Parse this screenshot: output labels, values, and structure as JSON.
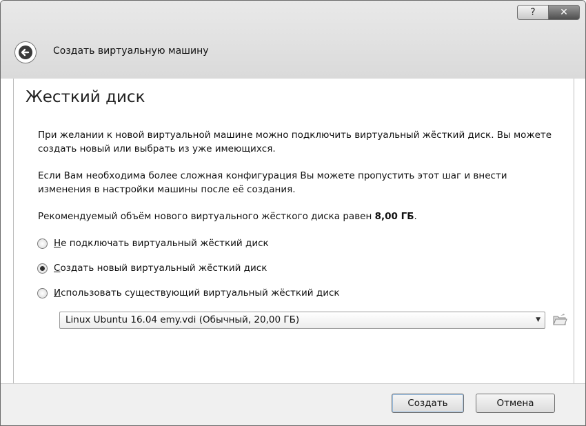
{
  "window": {
    "title": "Создать виртуальную машину",
    "help_glyph": "?",
    "close_glyph": "✕"
  },
  "page": {
    "heading": "Жесткий диск",
    "paragraph1": "При желании к новой виртуальной машине можно подключить виртуальный жёсткий диск. Вы можете создать новый или выбрать из уже имеющихся.",
    "paragraph2": "Если Вам необходима более сложная конфигурация Вы можете пропустить этот шаг и внести изменения в настройки машины после её создания.",
    "recommend_text": "Рекомендуемый объём нового виртуального жёсткого диска равен ",
    "recommend_size": "8,00 ГБ",
    "recommend_end": "."
  },
  "options": [
    {
      "accel": "Н",
      "rest": "е подключать виртуальный жёсткий диск",
      "selected": false
    },
    {
      "accel": "С",
      "rest": "оздать новый виртуальный жёсткий диск",
      "selected": true
    },
    {
      "accel": "И",
      "rest": "спользовать существующий виртуальный жёсткий диск",
      "selected": false
    }
  ],
  "disk_select": {
    "value": "Linux Ubuntu 16.04 emy.vdi (Обычный, 20,00 ГБ)",
    "arrow": "▼"
  },
  "buttons": {
    "create": "Создать",
    "cancel": "Отмена"
  },
  "icons": {
    "back": "back-arrow-icon",
    "folder": "folder-open-icon"
  }
}
